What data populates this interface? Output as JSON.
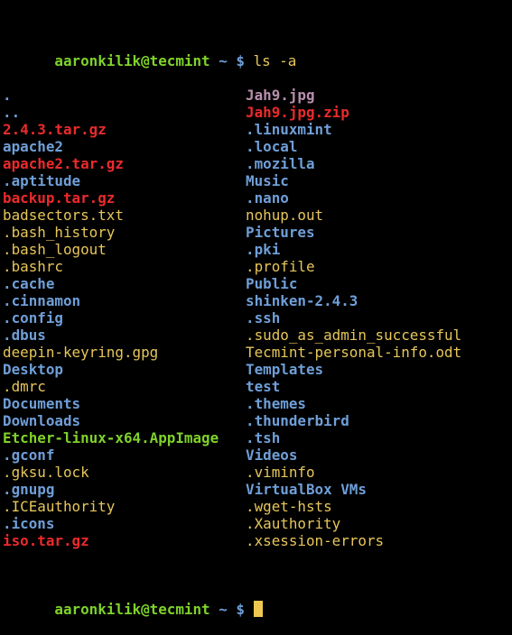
{
  "prompt": {
    "user_host": "aaronkilik@tecmint",
    "path": "~",
    "symbol": "$",
    "command": "ls -a"
  },
  "colors": {
    "directory": "#6f9fd8",
    "regular_file": "#e7c65a",
    "archive": "#ec2a2b",
    "image": "#b88fae",
    "executable": "#7fd22a",
    "cursor": "#f0c850",
    "background": "#000000"
  },
  "listing": {
    "left": [
      {
        "name": ".",
        "type": "dir"
      },
      {
        "name": "..",
        "type": "dir"
      },
      {
        "name": "2.4.3.tar.gz",
        "type": "arch"
      },
      {
        "name": "apache2",
        "type": "dir"
      },
      {
        "name": "apache2.tar.gz",
        "type": "arch"
      },
      {
        "name": ".aptitude",
        "type": "dir"
      },
      {
        "name": "backup.tar.gz",
        "type": "arch"
      },
      {
        "name": "badsectors.txt",
        "type": "file"
      },
      {
        "name": ".bash_history",
        "type": "file"
      },
      {
        "name": ".bash_logout",
        "type": "file"
      },
      {
        "name": ".bashrc",
        "type": "file"
      },
      {
        "name": ".cache",
        "type": "dir"
      },
      {
        "name": ".cinnamon",
        "type": "dir"
      },
      {
        "name": ".config",
        "type": "dir"
      },
      {
        "name": ".dbus",
        "type": "dir"
      },
      {
        "name": "deepin-keyring.gpg",
        "type": "file"
      },
      {
        "name": "Desktop",
        "type": "dir"
      },
      {
        "name": ".dmrc",
        "type": "file"
      },
      {
        "name": "Documents",
        "type": "dir"
      },
      {
        "name": "Downloads",
        "type": "dir"
      },
      {
        "name": "Etcher-linux-x64.AppImage",
        "type": "exec"
      },
      {
        "name": ".gconf",
        "type": "dir"
      },
      {
        "name": ".gksu.lock",
        "type": "file"
      },
      {
        "name": ".gnupg",
        "type": "dir"
      },
      {
        "name": ".ICEauthority",
        "type": "file"
      },
      {
        "name": ".icons",
        "type": "dir"
      },
      {
        "name": "iso.tar.gz",
        "type": "arch"
      }
    ],
    "right": [
      {
        "name": "Jah9.jpg",
        "type": "img"
      },
      {
        "name": "Jah9.jpg.zip",
        "type": "arch"
      },
      {
        "name": ".linuxmint",
        "type": "dir"
      },
      {
        "name": ".local",
        "type": "dir"
      },
      {
        "name": ".mozilla",
        "type": "dir"
      },
      {
        "name": "Music",
        "type": "dir"
      },
      {
        "name": ".nano",
        "type": "dir"
      },
      {
        "name": "nohup.out",
        "type": "file"
      },
      {
        "name": "Pictures",
        "type": "dir"
      },
      {
        "name": ".pki",
        "type": "dir"
      },
      {
        "name": ".profile",
        "type": "file"
      },
      {
        "name": "Public",
        "type": "dir"
      },
      {
        "name": "shinken-2.4.3",
        "type": "dir"
      },
      {
        "name": ".ssh",
        "type": "dir"
      },
      {
        "name": ".sudo_as_admin_successful",
        "type": "file"
      },
      {
        "name": "Tecmint-personal-info.odt",
        "type": "file"
      },
      {
        "name": "Templates",
        "type": "dir"
      },
      {
        "name": "test",
        "type": "dir"
      },
      {
        "name": ".themes",
        "type": "dir"
      },
      {
        "name": ".thunderbird",
        "type": "dir"
      },
      {
        "name": ".tsh",
        "type": "dir"
      },
      {
        "name": "Videos",
        "type": "dir"
      },
      {
        "name": ".viminfo",
        "type": "file"
      },
      {
        "name": "VirtualBox VMs",
        "type": "dir"
      },
      {
        "name": ".wget-hsts",
        "type": "file"
      },
      {
        "name": ".Xauthority",
        "type": "file"
      },
      {
        "name": ".xsession-errors",
        "type": "file"
      }
    ]
  },
  "final_prompt": {
    "user_host": "aaronkilik@tecmint",
    "path": "~",
    "symbol": "$"
  }
}
